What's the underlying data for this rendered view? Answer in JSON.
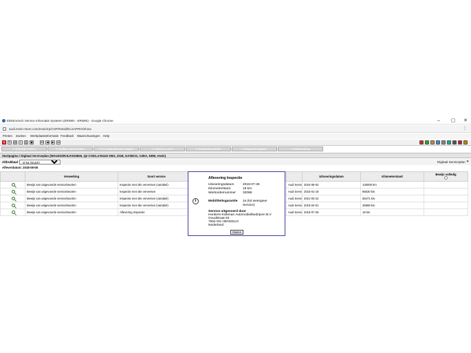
{
  "window": {
    "title": "Elektronisch Service Informatie Systeem (ERWIN - ERWIN) - Google Chrome",
    "url": "audi.erwin-store.com/erwin/rp/CSP/Retail/ELSAPRO/Show"
  },
  "menu": [
    "Printen",
    "Zoeken",
    "Werkplaatsinformatie",
    "Feedback",
    "Waarschuwingen",
    "Help"
  ],
  "tabs": [
    "1 Afspraak maken",
    "2 Afgiftel voorbereiden",
    "3 In ontvangstname wagen",
    "4 Uitvoeren werk",
    "5 Kwaliteitscontrole",
    "6 Wagenteruggave",
    "7 Nabewerking"
  ],
  "vehicle_info": "Startpagina / Digitaal Serviceplan (WAUZZZ8V4JA034926, Q2 COD1.4 R4110 D5G, 2018, GAS8CG, CZEA, 5396, erwin)",
  "language": {
    "label": "Afdrukbaal",
    "selected": "nl-NL (Dutch)"
  },
  "digital_service_plan": "Digitaal Serviceplan",
  "aflever_date": "Afleverdatum: 2018-08-08",
  "table": {
    "headers": [
      "Verwerking",
      "Soort service",
      "",
      "Uitvoeringsdatum",
      "Kilometerstand",
      "Bewijs volledig"
    ],
    "rows": [
      {
        "verwerking": "Bewijs van uitgevoerde servicebeurten",
        "soort": "Inspectie met olie verversen (variabel)",
        "dealer": "Audi Service",
        "datum": "2024-05-02",
        "km": "130000 km"
      },
      {
        "verwerking": "Bewijs van uitgevoerde servicebeurten",
        "soort": "Inspectie met olie verversen",
        "dealer": "Audi Service",
        "datum": "2023-01-18",
        "km": "85630 km"
      },
      {
        "verwerking": "Bewijs van uitgevoerde servicebeurten",
        "soort": "Inspectie met olie verversen (variabel)",
        "dealer": "Audi Service",
        "datum": "2021-03-22",
        "km": "55471 km"
      },
      {
        "verwerking": "Bewijs van uitgevoerde servicebeurten",
        "soort": "Inspectie met olie verversen (variabel)",
        "dealer": "Audi Service",
        "datum": "2019-04-01",
        "km": "26568 km"
      },
      {
        "verwerking": "Bewijs van uitgevoerde servicebeurten",
        "soort": "Aflevering Inspectie",
        "dealer": "Audi Service",
        "datum": "2018-07-26",
        "km": "18 km"
      }
    ]
  },
  "dialog": {
    "title": "Aflevering Inspectie",
    "fields": [
      {
        "label": "Uitvoeringsdatum",
        "value": "2018-07-26"
      },
      {
        "label": "Kilometerstand",
        "value": "18 km"
      },
      {
        "label": "Werkordernummer",
        "value": "32068"
      }
    ],
    "mobility_label": "Mobiliteitsgarantie",
    "mobility_value_1": "Ja (tot weergave",
    "mobility_value_2": "Service)",
    "service_by_label": "Service uitgevoerd door",
    "dealer_lines": [
      "Hunkers-Kolkman Automobielbedrijven B.V",
      "Goudstraat 63",
      "7554 NG HENGELO",
      "Nederland"
    ],
    "close_label": "Sluiten"
  },
  "icons": {
    "tool_right": [
      "#d22",
      "#2a2",
      "#c84",
      "#48c",
      "#888",
      "#2a8",
      "#555",
      "#c22",
      "#b80"
    ]
  }
}
